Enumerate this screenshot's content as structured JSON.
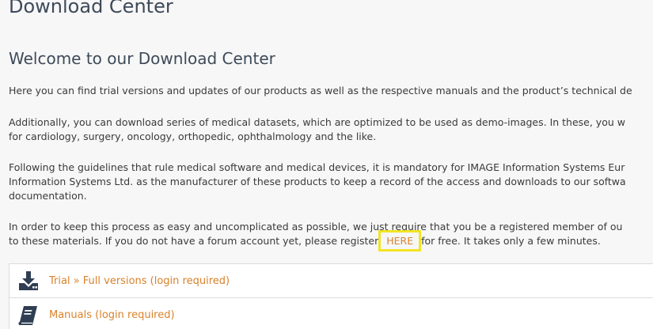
{
  "header": {
    "title": "Download Center"
  },
  "main": {
    "welcome_title": "Welcome to our Download Center",
    "paragraphs": {
      "p1_line1": "Here you can find trial versions and updates of our products as well as the respective manuals and the product’s technical de",
      "p2_line1": "Additionally, you can download series of medical datasets, which are optimized to be used as demo-images. In these, you w",
      "p2_line2": "for cardiology, surgery, oncology, orthopedic, ophthalmology and the like.",
      "p3_line1": "Following the guidelines that rule medical software and medical devices, it is mandatory for IMAGE Information Systems Eur",
      "p3_line2": "Information Systems Ltd. as the manufacturer of these products to keep a record of the access and downloads to our softwa",
      "p3_line3": "documentation.",
      "p4_line1": "In order to keep this process as easy and uncomplicated as possible, we just require that you be a registered member of ou",
      "p4_line2_before": "to these materials. If you do not have a forum account yet, please register ",
      "p4_line2_link": "HERE",
      "p4_line2_after": " for free. It takes only a few minutes."
    },
    "downloads": {
      "items": [
        {
          "label": "Trial » Full versions (login required)",
          "icon": "download-tray-icon"
        },
        {
          "label": "Manuals (login required)",
          "icon": "book-icon"
        }
      ]
    }
  },
  "colors": {
    "link": "#d9822b",
    "highlight": "#f2e424",
    "icon": "#2f3e52"
  }
}
